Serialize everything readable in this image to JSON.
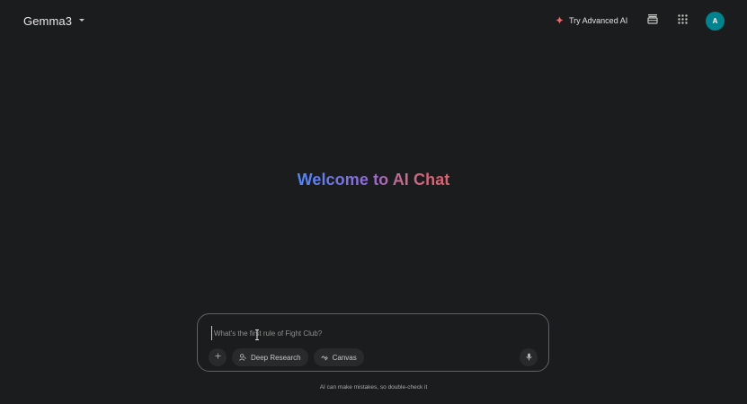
{
  "header": {
    "model_name": "Gemma3",
    "try_advanced_label": "Try Advanced AI",
    "avatar_initial": "A"
  },
  "welcome": {
    "title": "Welcome to AI Chat"
  },
  "composer": {
    "placeholder": "What's the first rule of Fight Club?",
    "value": "",
    "deep_research_label": "Deep Research",
    "canvas_label": "Canvas"
  },
  "footer": {
    "disclaimer": "AI can make mistakes, so double-check it"
  },
  "colors": {
    "background": "#1b1c1d",
    "sparkle": "#e56a6a",
    "avatar": "#00838f",
    "gradient_start": "#4f86f7",
    "gradient_end": "#d96270"
  },
  "icons": {
    "sparkle": "sparkle-icon",
    "history": "history-icon",
    "apps": "apps-grid-icon",
    "plus": "plus-icon",
    "deep_research": "deep-research-icon",
    "canvas": "canvas-icon",
    "mic": "mic-icon"
  }
}
